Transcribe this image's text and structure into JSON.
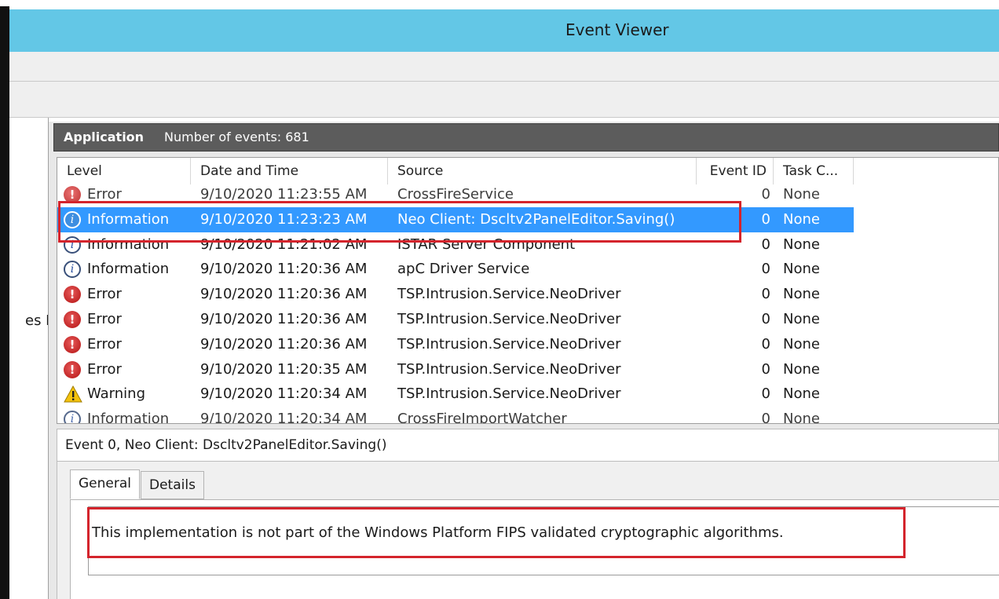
{
  "window": {
    "title": "Event Viewer"
  },
  "tree": {
    "partial_item_text": "es Lo"
  },
  "log": {
    "name": "Application",
    "count_text": "Number of events: 681"
  },
  "columns": [
    "Level",
    "Date and Time",
    "Source",
    "Event ID",
    "Task C..."
  ],
  "events": [
    {
      "level": "Error",
      "icon": "error-icon",
      "datetime": "9/10/2020 11:23:55 AM",
      "source": "CrossFireService",
      "event_id": "0",
      "task": "None"
    },
    {
      "level": "Information",
      "icon": "info-icon",
      "datetime": "9/10/2020 11:23:23 AM",
      "source": "Neo Client: Dscltv2PanelEditor.Saving()",
      "event_id": "0",
      "task": "None"
    },
    {
      "level": "Information",
      "icon": "info-icon",
      "datetime": "9/10/2020 11:21:02 AM",
      "source": "ISTAR Server Component",
      "event_id": "0",
      "task": "None"
    },
    {
      "level": "Information",
      "icon": "info-icon",
      "datetime": "9/10/2020 11:20:36 AM",
      "source": "apC Driver Service",
      "event_id": "0",
      "task": "None"
    },
    {
      "level": "Error",
      "icon": "error-icon",
      "datetime": "9/10/2020 11:20:36 AM",
      "source": "TSP.Intrusion.Service.NeoDriver",
      "event_id": "0",
      "task": "None"
    },
    {
      "level": "Error",
      "icon": "error-icon",
      "datetime": "9/10/2020 11:20:36 AM",
      "source": "TSP.Intrusion.Service.NeoDriver",
      "event_id": "0",
      "task": "None"
    },
    {
      "level": "Error",
      "icon": "error-icon",
      "datetime": "9/10/2020 11:20:36 AM",
      "source": "TSP.Intrusion.Service.NeoDriver",
      "event_id": "0",
      "task": "None"
    },
    {
      "level": "Error",
      "icon": "error-icon",
      "datetime": "9/10/2020 11:20:35 AM",
      "source": "TSP.Intrusion.Service.NeoDriver",
      "event_id": "0",
      "task": "None"
    },
    {
      "level": "Warning",
      "icon": "warning-icon",
      "datetime": "9/10/2020 11:20:34 AM",
      "source": "TSP.Intrusion.Service.NeoDriver",
      "event_id": "0",
      "task": "None"
    },
    {
      "level": "Information",
      "icon": "info-icon",
      "datetime": "9/10/2020 11:20:34 AM",
      "source": "CrossFireImportWatcher",
      "event_id": "0",
      "task": "None"
    }
  ],
  "selected_index": 1,
  "detail": {
    "header": "Event 0, Neo Client: Dscltv2PanelEditor.Saving()",
    "tabs": [
      "General",
      "Details"
    ],
    "active_tab": "General",
    "message": "This implementation is not part of the Windows Platform FIPS validated cryptographic algorithms."
  },
  "colors": {
    "titlebar": "#63c7e6",
    "selection": "#3399ff",
    "highlight": "#d4242c"
  }
}
